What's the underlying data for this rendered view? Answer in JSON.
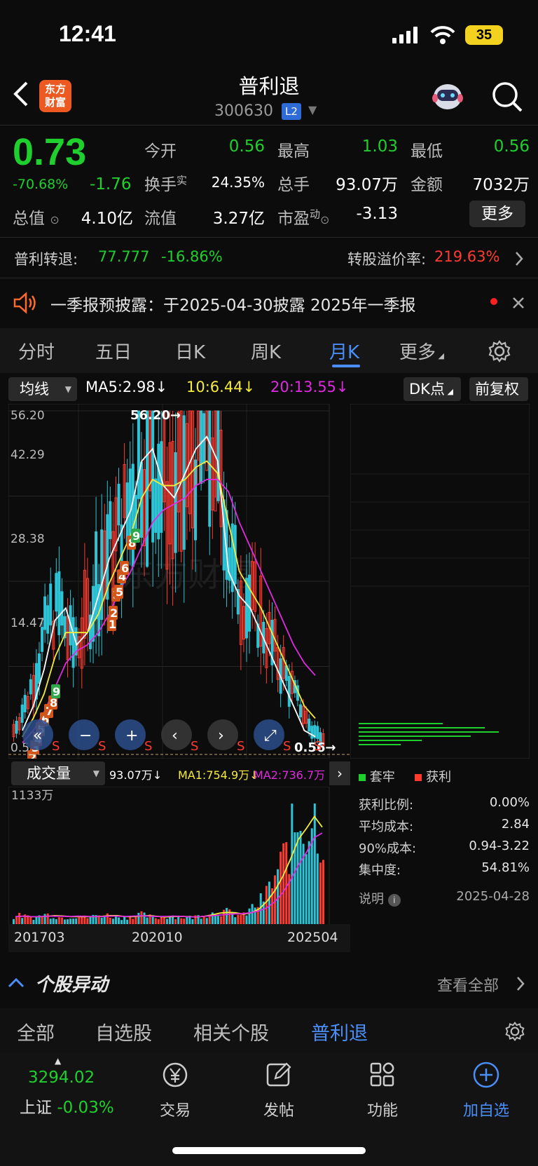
{
  "status_bar": {
    "time": "12:41",
    "battery": "35"
  },
  "header": {
    "stock_name": "普利退",
    "stock_code": "300630",
    "level": "L2",
    "logo_text": [
      "东方",
      "财富"
    ]
  },
  "quote": {
    "price": "0.73",
    "change_pct": "-70.68%",
    "change": "-1.76",
    "fields": {
      "open_label": "今开",
      "open": "0.56",
      "high_label": "最高",
      "high": "1.03",
      "low_label": "最低",
      "low": "0.56",
      "turnover_label": "换手",
      "turnover_sup": "实",
      "turnover": "24.35%",
      "volume_label": "总手",
      "volume": "93.07万",
      "amount_label": "金额",
      "amount": "7032万",
      "mktcap_label": "总值",
      "mktcap": "4.10亿",
      "float_label": "流值",
      "float": "3.27亿",
      "pe_label": "市盈",
      "pe_sup": "动",
      "pe": "-3.13"
    },
    "more_label": "更多"
  },
  "bond": {
    "label": "普利转退:",
    "price": "77.777",
    "pct": "-16.86%",
    "premium_label": "转股溢价率:",
    "premium": "219.63%"
  },
  "notice": {
    "text": "一季报预披露：于2025-04-30披露 2025年一季报"
  },
  "kline_tabs": [
    "分时",
    "五日",
    "日K",
    "周K",
    "月K",
    "更多"
  ],
  "active_tab_index": 4,
  "ma": {
    "selector": "均线",
    "ma5": "MA5:2.98↓",
    "ma10": "10:6.44↓",
    "ma20": "20:13.55↓",
    "dk_label": "DK点",
    "adjust_label": "前复权"
  },
  "colors": {
    "up": "#ff3b30",
    "down": "#1fcf2d",
    "accent": "#4a8ef7",
    "ma5": "#ffffff",
    "ma10": "#f5ec3b",
    "ma20": "#e02ae0",
    "candle_down": "#2ec4d6"
  },
  "kchart": {
    "y_ticks": [
      "56.20",
      "42.29",
      "28.38",
      "14.47",
      "0.56"
    ],
    "max_marker": "56.20→",
    "min_marker": "0.56→",
    "watermark": "东方财富",
    "td_labels": [
      "1",
      "2",
      "3",
      "4",
      "5",
      "6",
      "7",
      "8",
      "9",
      "1",
      "2",
      "3",
      "5",
      "4",
      "6",
      "8",
      "9"
    ],
    "s_markers": [
      "S",
      "S",
      "S",
      "S",
      "S",
      "S",
      "S"
    ]
  },
  "chart_data": {
    "type": "candlestick",
    "title": "",
    "ylim": [
      0.56,
      56.2
    ],
    "series": [
      {
        "name": "MA5",
        "values": [
          4,
          8,
          14,
          22,
          24,
          18,
          20,
          26,
          32,
          36,
          40,
          48,
          50,
          44,
          42,
          46,
          50,
          52,
          48,
          30,
          26,
          24,
          20,
          16,
          12,
          8,
          4,
          3
        ]
      },
      {
        "name": "MA10",
        "values": [
          3,
          6,
          10,
          16,
          20,
          20,
          20,
          23,
          28,
          32,
          36,
          42,
          45,
          44,
          44,
          45,
          47,
          48,
          46,
          38,
          30,
          27,
          24,
          20,
          16,
          12,
          8,
          6
        ]
      },
      {
        "name": "MA20",
        "values": [
          2,
          4,
          7,
          11,
          15,
          17,
          18,
          20,
          23,
          27,
          30,
          34,
          38,
          40,
          41,
          42,
          44,
          45,
          45,
          43,
          38,
          34,
          30,
          26,
          22,
          18,
          15,
          13
        ]
      }
    ],
    "volume": {
      "ylabel": "1133万",
      "values": [
        70,
        80,
        60,
        70,
        90,
        80,
        60,
        70,
        80,
        60,
        70,
        90,
        80,
        70,
        60,
        80,
        90,
        70,
        60,
        70,
        80,
        70,
        60,
        70,
        90,
        100,
        120,
        110,
        90,
        80,
        150,
        200,
        300,
        450,
        600,
        800,
        1000,
        900,
        1133,
        700
      ],
      "ma1": "MA1:754.9万↓",
      "ma2": "MA2:736.7万",
      "current": "93.07万",
      "selector": "成交量"
    },
    "x_ticks": [
      "201703",
      "202010",
      "202504"
    ]
  },
  "chips": {
    "legend_trap": "套牢",
    "legend_profit": "获利",
    "rows": [
      {
        "label": "获利比例:",
        "value": "0.00%"
      },
      {
        "label": "平均成本:",
        "value": "2.84"
      },
      {
        "label": "90%成本:",
        "value": "0.94-3.22"
      },
      {
        "label": "集中度:",
        "value": "54.81%"
      }
    ],
    "note_label": "说明",
    "date": "2025-04-28"
  },
  "anomaly": {
    "title": "个股异动",
    "view_all": "查看全部"
  },
  "sub_tabs": [
    "全部",
    "自选股",
    "相关个股",
    "普利退"
  ],
  "active_sub_tab": 3,
  "bottom_nav": {
    "index_value": "3294.02",
    "index_name": "上证",
    "index_pct": "-0.03%",
    "items": [
      "交易",
      "发帖",
      "功能",
      "加自选"
    ]
  }
}
